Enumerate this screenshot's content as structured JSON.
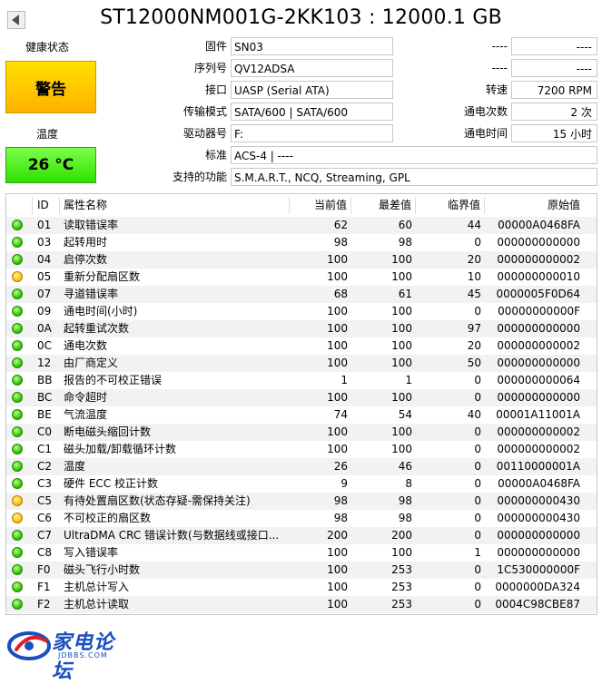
{
  "title": "ST12000NM001G-2KK103 : 12000.1 GB",
  "health": {
    "label": "健康状态",
    "status": "警告"
  },
  "temperature": {
    "label": "温度",
    "value": "26 °C"
  },
  "info": {
    "firmware": {
      "label": "固件",
      "value": "SN03"
    },
    "serial": {
      "label": "序列号",
      "value": "QV12ADSA"
    },
    "interface": {
      "label": "接口",
      "value": "UASP (Serial ATA)"
    },
    "transfer_mode": {
      "label": "传输模式",
      "value": "SATA/600 | SATA/600"
    },
    "drive_letter": {
      "label": "驱动器号",
      "value": "F:"
    },
    "standard": {
      "label": "标准",
      "value": "ACS-4 | ----"
    },
    "features": {
      "label": "支持的功能",
      "value": "S.M.A.R.T., NCQ, Streaming, GPL"
    },
    "right_blank1": {
      "label": "----",
      "value": "----"
    },
    "right_blank2": {
      "label": "----",
      "value": "----"
    },
    "rotation": {
      "label": "转速",
      "value": "7200 RPM"
    },
    "power_on_count": {
      "label": "通电次数",
      "value": "2 次"
    },
    "power_on_hours": {
      "label": "通电时间",
      "value": "15 小时"
    }
  },
  "table": {
    "headers": {
      "id": "ID",
      "name": "属性名称",
      "current": "当前值",
      "worst": "最差值",
      "threshold": "临界值",
      "raw": "原始值"
    },
    "rows": [
      {
        "status": "good",
        "id": "01",
        "name": "读取错误率",
        "current": "62",
        "worst": "60",
        "threshold": "44",
        "raw": "00000A0468FA"
      },
      {
        "status": "good",
        "id": "03",
        "name": "起转用时",
        "current": "98",
        "worst": "98",
        "threshold": "0",
        "raw": "000000000000"
      },
      {
        "status": "good",
        "id": "04",
        "name": "启停次数",
        "current": "100",
        "worst": "100",
        "threshold": "20",
        "raw": "000000000002"
      },
      {
        "status": "caution",
        "id": "05",
        "name": "重新分配扇区数",
        "current": "100",
        "worst": "100",
        "threshold": "10",
        "raw": "000000000010"
      },
      {
        "status": "good",
        "id": "07",
        "name": "寻道错误率",
        "current": "68",
        "worst": "61",
        "threshold": "45",
        "raw": "0000005F0D64"
      },
      {
        "status": "good",
        "id": "09",
        "name": "通电时间(小时)",
        "current": "100",
        "worst": "100",
        "threshold": "0",
        "raw": "00000000000F"
      },
      {
        "status": "good",
        "id": "0A",
        "name": "起转重试次数",
        "current": "100",
        "worst": "100",
        "threshold": "97",
        "raw": "000000000000"
      },
      {
        "status": "good",
        "id": "0C",
        "name": "通电次数",
        "current": "100",
        "worst": "100",
        "threshold": "20",
        "raw": "000000000002"
      },
      {
        "status": "good",
        "id": "12",
        "name": "由厂商定义",
        "current": "100",
        "worst": "100",
        "threshold": "50",
        "raw": "000000000000"
      },
      {
        "status": "good",
        "id": "BB",
        "name": "报告的不可校正错误",
        "current": "1",
        "worst": "1",
        "threshold": "0",
        "raw": "000000000064"
      },
      {
        "status": "good",
        "id": "BC",
        "name": "命令超时",
        "current": "100",
        "worst": "100",
        "threshold": "0",
        "raw": "000000000000"
      },
      {
        "status": "good",
        "id": "BE",
        "name": "气流温度",
        "current": "74",
        "worst": "54",
        "threshold": "40",
        "raw": "00001A11001A"
      },
      {
        "status": "good",
        "id": "C0",
        "name": "断电磁头缩回计数",
        "current": "100",
        "worst": "100",
        "threshold": "0",
        "raw": "000000000002"
      },
      {
        "status": "good",
        "id": "C1",
        "name": "磁头加载/卸载循环计数",
        "current": "100",
        "worst": "100",
        "threshold": "0",
        "raw": "000000000002"
      },
      {
        "status": "good",
        "id": "C2",
        "name": "温度",
        "current": "26",
        "worst": "46",
        "threshold": "0",
        "raw": "00110000001A"
      },
      {
        "status": "good",
        "id": "C3",
        "name": "硬件 ECC 校正计数",
        "current": "9",
        "worst": "8",
        "threshold": "0",
        "raw": "00000A0468FA"
      },
      {
        "status": "caution",
        "id": "C5",
        "name": "有待处置扇区数(状态存疑-需保持关注)",
        "current": "98",
        "worst": "98",
        "threshold": "0",
        "raw": "000000000430"
      },
      {
        "status": "caution",
        "id": "C6",
        "name": "不可校正的扇区数",
        "current": "98",
        "worst": "98",
        "threshold": "0",
        "raw": "000000000430"
      },
      {
        "status": "good",
        "id": "C7",
        "name": "UltraDMA CRC 错误计数(与数据线或接口...",
        "current": "200",
        "worst": "200",
        "threshold": "0",
        "raw": "000000000000"
      },
      {
        "status": "good",
        "id": "C8",
        "name": "写入错误率",
        "current": "100",
        "worst": "100",
        "threshold": "1",
        "raw": "000000000000"
      },
      {
        "status": "good",
        "id": "F0",
        "name": "磁头飞行小时数",
        "current": "100",
        "worst": "253",
        "threshold": "0",
        "raw": "1C530000000F"
      },
      {
        "status": "good",
        "id": "F1",
        "name": "主机总计写入",
        "current": "100",
        "worst": "253",
        "threshold": "0",
        "raw": "0000000DA324"
      },
      {
        "status": "good",
        "id": "F2",
        "name": "主机总计读取",
        "current": "100",
        "worst": "253",
        "threshold": "0",
        "raw": "0004C98CBE87"
      }
    ]
  },
  "logo": {
    "text": "家电论坛",
    "sub": "JDBBS.COM",
    "icon": "jdbbs-logo-icon"
  },
  "colors": {
    "warning_yellow": "#ffd000",
    "temp_green": "#39e60a",
    "good_dot": "#31c800",
    "caution_dot": "#ffc400"
  }
}
